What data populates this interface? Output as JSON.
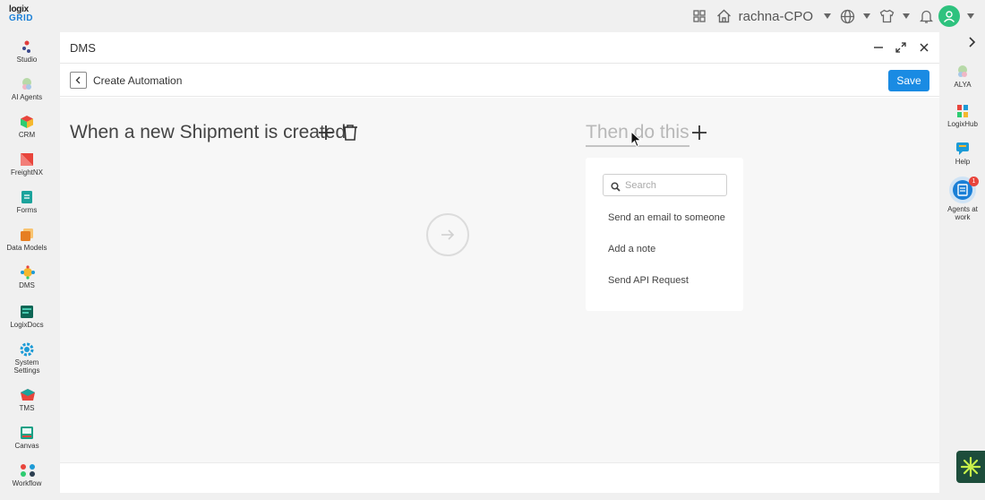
{
  "app": {
    "logo_line1": "logix",
    "logo_line2": "GRID"
  },
  "topbar": {
    "user_name": "rachna-CPO",
    "icons": [
      "apps-grid-icon",
      "home-icon",
      "globe-icon",
      "shirt-icon",
      "bell-icon",
      "user-avatar-icon"
    ]
  },
  "sidebar": {
    "items": [
      {
        "label": "Studio",
        "icon": "studio-icon",
        "color": "#e03c3c"
      },
      {
        "label": "AI Agents",
        "icon": "ai-agents-icon",
        "color": "#7fb07a"
      },
      {
        "label": "CRM",
        "icon": "crm-icon",
        "color": "#e8453c"
      },
      {
        "label": "FreightNX",
        "icon": "freightnx-icon",
        "color": "#e8453c"
      },
      {
        "label": "Forms",
        "icon": "forms-icon",
        "color": "#1ba39c"
      },
      {
        "label": "Data Models",
        "icon": "data-models-icon",
        "color": "#f39c12"
      },
      {
        "label": "DMS",
        "icon": "dms-icon",
        "color": "#f5b82e"
      },
      {
        "label": "LogixDocs",
        "icon": "logixdocs-icon",
        "color": "#16a085"
      },
      {
        "label": "System Settings",
        "icon": "settings-icon",
        "color": "#1d9bd6"
      },
      {
        "label": "TMS",
        "icon": "tms-icon",
        "color": "#e8453c"
      },
      {
        "label": "Canvas",
        "icon": "canvas-icon",
        "color": "#16a085"
      },
      {
        "label": "Workflow",
        "icon": "workflow-icon",
        "color": "#e8453c"
      }
    ]
  },
  "rightbar": {
    "items": [
      {
        "label": "ALYA",
        "icon": "alya-icon"
      },
      {
        "label": "LogixHub",
        "icon": "logixhub-icon"
      },
      {
        "label": "Help",
        "icon": "help-icon"
      },
      {
        "label": "Agents at work",
        "icon": "agents-at-work-icon",
        "badge": "1"
      }
    ]
  },
  "panel": {
    "title": "DMS",
    "subtitle": "Create Automation",
    "save_label": "Save"
  },
  "automation": {
    "trigger_text": "When a new Shipment is created",
    "then_text": "Then do this",
    "search_placeholder": "Search",
    "actions": [
      "Send an email to someone",
      "Add a note",
      "Send API Request"
    ]
  },
  "colors": {
    "accent": "#1a8be3",
    "avatar": "#2ec27e"
  }
}
